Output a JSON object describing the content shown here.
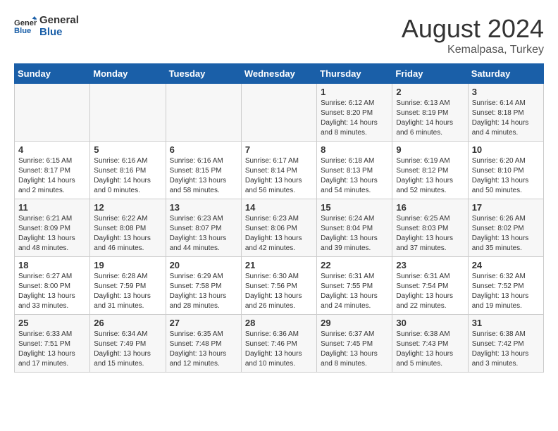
{
  "logo": {
    "text_general": "General",
    "text_blue": "Blue"
  },
  "title": {
    "month_year": "August 2024",
    "location": "Kemalpasa, Turkey"
  },
  "headers": [
    "Sunday",
    "Monday",
    "Tuesday",
    "Wednesday",
    "Thursday",
    "Friday",
    "Saturday"
  ],
  "weeks": [
    [
      {
        "day": "",
        "info": ""
      },
      {
        "day": "",
        "info": ""
      },
      {
        "day": "",
        "info": ""
      },
      {
        "day": "",
        "info": ""
      },
      {
        "day": "1",
        "info": "Sunrise: 6:12 AM\nSunset: 8:20 PM\nDaylight: 14 hours\nand 8 minutes."
      },
      {
        "day": "2",
        "info": "Sunrise: 6:13 AM\nSunset: 8:19 PM\nDaylight: 14 hours\nand 6 minutes."
      },
      {
        "day": "3",
        "info": "Sunrise: 6:14 AM\nSunset: 8:18 PM\nDaylight: 14 hours\nand 4 minutes."
      }
    ],
    [
      {
        "day": "4",
        "info": "Sunrise: 6:15 AM\nSunset: 8:17 PM\nDaylight: 14 hours\nand 2 minutes."
      },
      {
        "day": "5",
        "info": "Sunrise: 6:16 AM\nSunset: 8:16 PM\nDaylight: 14 hours\nand 0 minutes."
      },
      {
        "day": "6",
        "info": "Sunrise: 6:16 AM\nSunset: 8:15 PM\nDaylight: 13 hours\nand 58 minutes."
      },
      {
        "day": "7",
        "info": "Sunrise: 6:17 AM\nSunset: 8:14 PM\nDaylight: 13 hours\nand 56 minutes."
      },
      {
        "day": "8",
        "info": "Sunrise: 6:18 AM\nSunset: 8:13 PM\nDaylight: 13 hours\nand 54 minutes."
      },
      {
        "day": "9",
        "info": "Sunrise: 6:19 AM\nSunset: 8:12 PM\nDaylight: 13 hours\nand 52 minutes."
      },
      {
        "day": "10",
        "info": "Sunrise: 6:20 AM\nSunset: 8:10 PM\nDaylight: 13 hours\nand 50 minutes."
      }
    ],
    [
      {
        "day": "11",
        "info": "Sunrise: 6:21 AM\nSunset: 8:09 PM\nDaylight: 13 hours\nand 48 minutes."
      },
      {
        "day": "12",
        "info": "Sunrise: 6:22 AM\nSunset: 8:08 PM\nDaylight: 13 hours\nand 46 minutes."
      },
      {
        "day": "13",
        "info": "Sunrise: 6:23 AM\nSunset: 8:07 PM\nDaylight: 13 hours\nand 44 minutes."
      },
      {
        "day": "14",
        "info": "Sunrise: 6:23 AM\nSunset: 8:06 PM\nDaylight: 13 hours\nand 42 minutes."
      },
      {
        "day": "15",
        "info": "Sunrise: 6:24 AM\nSunset: 8:04 PM\nDaylight: 13 hours\nand 39 minutes."
      },
      {
        "day": "16",
        "info": "Sunrise: 6:25 AM\nSunset: 8:03 PM\nDaylight: 13 hours\nand 37 minutes."
      },
      {
        "day": "17",
        "info": "Sunrise: 6:26 AM\nSunset: 8:02 PM\nDaylight: 13 hours\nand 35 minutes."
      }
    ],
    [
      {
        "day": "18",
        "info": "Sunrise: 6:27 AM\nSunset: 8:00 PM\nDaylight: 13 hours\nand 33 minutes."
      },
      {
        "day": "19",
        "info": "Sunrise: 6:28 AM\nSunset: 7:59 PM\nDaylight: 13 hours\nand 31 minutes."
      },
      {
        "day": "20",
        "info": "Sunrise: 6:29 AM\nSunset: 7:58 PM\nDaylight: 13 hours\nand 28 minutes."
      },
      {
        "day": "21",
        "info": "Sunrise: 6:30 AM\nSunset: 7:56 PM\nDaylight: 13 hours\nand 26 minutes."
      },
      {
        "day": "22",
        "info": "Sunrise: 6:31 AM\nSunset: 7:55 PM\nDaylight: 13 hours\nand 24 minutes."
      },
      {
        "day": "23",
        "info": "Sunrise: 6:31 AM\nSunset: 7:54 PM\nDaylight: 13 hours\nand 22 minutes."
      },
      {
        "day": "24",
        "info": "Sunrise: 6:32 AM\nSunset: 7:52 PM\nDaylight: 13 hours\nand 19 minutes."
      }
    ],
    [
      {
        "day": "25",
        "info": "Sunrise: 6:33 AM\nSunset: 7:51 PM\nDaylight: 13 hours\nand 17 minutes."
      },
      {
        "day": "26",
        "info": "Sunrise: 6:34 AM\nSunset: 7:49 PM\nDaylight: 13 hours\nand 15 minutes."
      },
      {
        "day": "27",
        "info": "Sunrise: 6:35 AM\nSunset: 7:48 PM\nDaylight: 13 hours\nand 12 minutes."
      },
      {
        "day": "28",
        "info": "Sunrise: 6:36 AM\nSunset: 7:46 PM\nDaylight: 13 hours\nand 10 minutes."
      },
      {
        "day": "29",
        "info": "Sunrise: 6:37 AM\nSunset: 7:45 PM\nDaylight: 13 hours\nand 8 minutes."
      },
      {
        "day": "30",
        "info": "Sunrise: 6:38 AM\nSunset: 7:43 PM\nDaylight: 13 hours\nand 5 minutes."
      },
      {
        "day": "31",
        "info": "Sunrise: 6:38 AM\nSunset: 7:42 PM\nDaylight: 13 hours\nand 3 minutes."
      }
    ]
  ]
}
